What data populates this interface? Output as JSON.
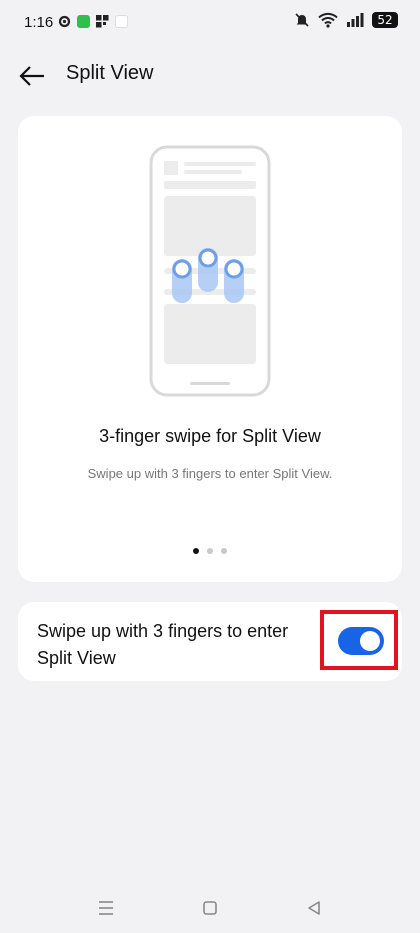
{
  "status": {
    "time": "1:16",
    "battery": "52",
    "icons": [
      "gear-icon",
      "app-icon-green",
      "widget-icon",
      "notification-icon",
      "mute-icon",
      "wifi-icon",
      "signal-icon"
    ]
  },
  "header": {
    "title": "Split View",
    "back_icon": "arrow-left-icon"
  },
  "illustration": {
    "title": "3-finger swipe for Split View",
    "subtitle": "Swipe up with 3 fingers to enter Split View.",
    "page_indicator": {
      "count": 3,
      "active": 1
    }
  },
  "setting": {
    "label": "Swipe up with 3 fingers to enter Split View",
    "enabled": true
  },
  "colors": {
    "accent": "#1864e6",
    "highlight": "#e0141e"
  },
  "nav": {
    "icons": [
      "menu-icon",
      "home-icon",
      "back-triangle-icon"
    ]
  }
}
